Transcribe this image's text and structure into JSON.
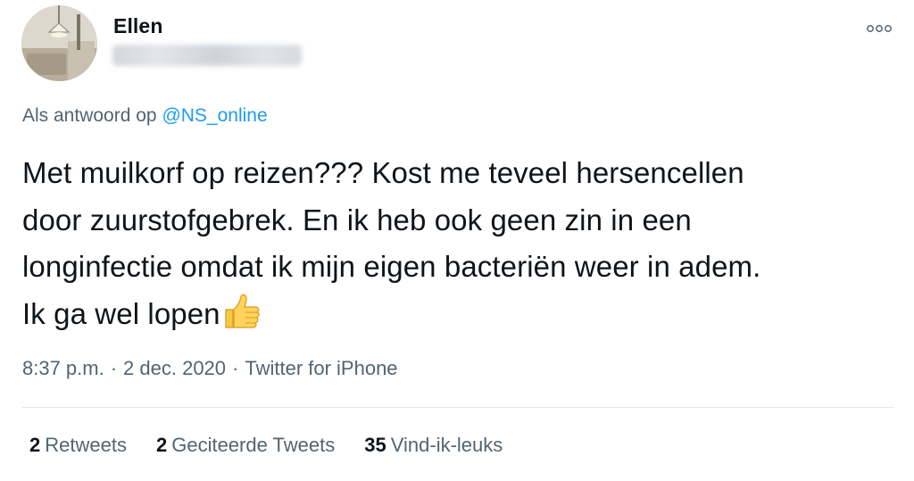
{
  "author": {
    "name": "Ellen",
    "handle_blurred": true
  },
  "more_icon": "more-horizontal-icon",
  "reply_to": {
    "prefix": "Als antwoord op",
    "mention": "@NS_online"
  },
  "tweet": {
    "lines": [
      "Met muilkorf op reizen??? Kost me teveel hersencellen",
      "door zuurstofgebrek. En ik heb ook geen zin in een",
      "longinfectie omdat ik mijn eigen bacteriën weer in adem.",
      "Ik ga wel lopen"
    ],
    "emoji": "thumbs-up"
  },
  "meta": {
    "time": "8:37 p.m.",
    "separator": "·",
    "date": "2 dec. 2020",
    "source": "Twitter for iPhone"
  },
  "stats": {
    "retweets_count": "2",
    "retweets_label": "Retweets",
    "quotes_count": "2",
    "quotes_label": "Geciteerde Tweets",
    "likes_count": "35",
    "likes_label": "Vind-ik-leuks"
  },
  "colors": {
    "link": "#1d9bf0",
    "secondary_text": "#536471",
    "primary_text": "#0f1419",
    "divider": "#e4e8eb"
  }
}
